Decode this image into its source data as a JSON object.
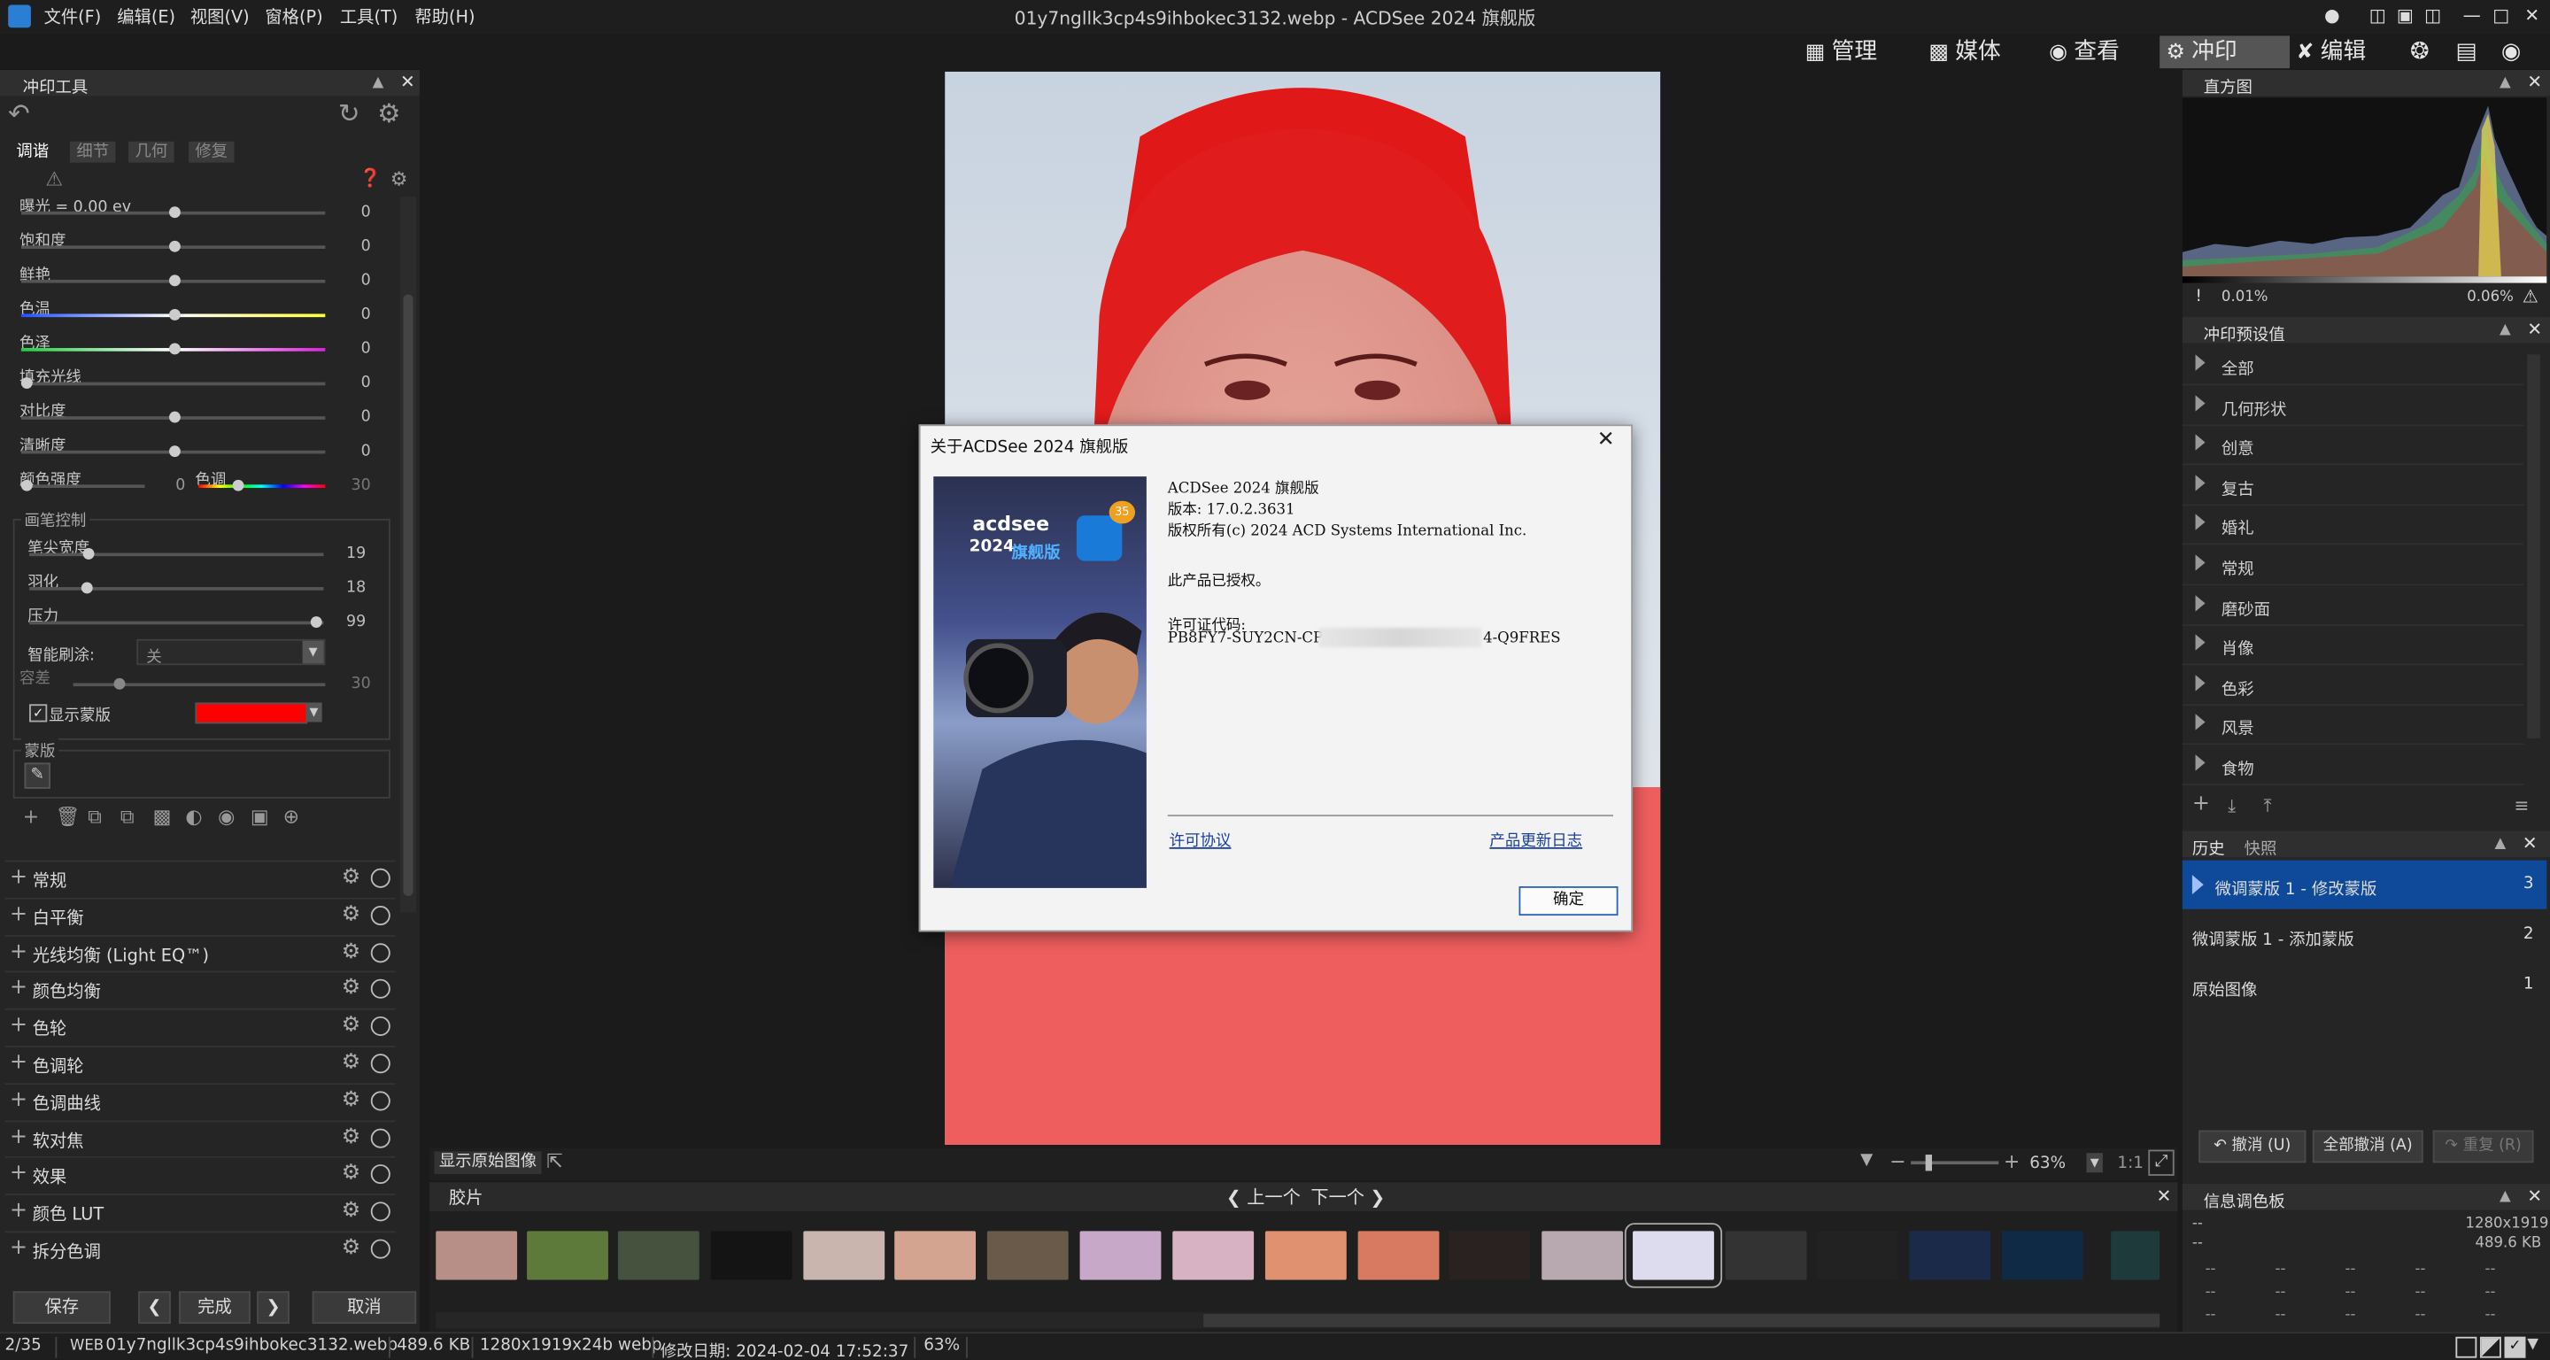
{
  "window": {
    "title": "01y7ngllk3cp4s9ihbokec3132.webp - ACDSee 2024 旗舰版"
  },
  "menu": [
    "文件(F)",
    "编辑(E)",
    "视图(V)",
    "窗格(P)",
    "工具(T)",
    "帮助(H)"
  ],
  "modes": [
    {
      "label": "管理",
      "icon": "grid-icon"
    },
    {
      "label": "媒体",
      "icon": "media-icon"
    },
    {
      "label": "查看",
      "icon": "eye-icon"
    },
    {
      "label": "冲印",
      "icon": "develop-icon",
      "active": true
    },
    {
      "label": "编辑",
      "icon": "edit-icon"
    }
  ],
  "left_panel": {
    "title": "冲印工具",
    "tabs": [
      "调谐",
      "细节",
      "几何",
      "修复"
    ],
    "sliders": [
      {
        "label": "曝光 = 0.00 ev",
        "value": "0",
        "pos": 0.5
      },
      {
        "label": "饱和度",
        "value": "0",
        "pos": 0.5
      },
      {
        "label": "鲜艳",
        "value": "0",
        "pos": 0.5
      },
      {
        "label": "色温",
        "value": "0",
        "pos": 0.5
      },
      {
        "label": "色泽",
        "value": "0",
        "pos": 0.5
      },
      {
        "label": "填充光线",
        "value": "0",
        "pos": 0.0
      },
      {
        "label": "对比度",
        "value": "0",
        "pos": 0.5
      },
      {
        "label": "清晰度",
        "value": "0",
        "pos": 0.5
      }
    ],
    "color_strength": {
      "label": "颜色强度",
      "hue_label": "色调",
      "value1": "0",
      "value2": "30"
    },
    "brush": {
      "title": "画笔控制",
      "sliders": [
        {
          "label": "笔尖宽度",
          "value": "19",
          "pos": 0.19
        },
        {
          "label": "羽化",
          "value": "18",
          "pos": 0.18
        },
        {
          "label": "压力",
          "value": "99",
          "pos": 0.99
        }
      ],
      "smart_brush_label": "智能刷涂:",
      "smart_brush_value": "关",
      "tolerance_label": "容差",
      "tolerance_value": "30",
      "show_mask_label": "显示蒙版",
      "mask_color": "#ff0000"
    },
    "mask_title": "蒙版",
    "sections": [
      "常规",
      "白平衡",
      "光线均衡 (Light EQ™)",
      "颜色均衡",
      "色轮",
      "色调轮",
      "色调曲线",
      "软对焦",
      "效果",
      "颜色 LUT",
      "拆分色调"
    ],
    "buttons": {
      "save": "保存",
      "done": "完成",
      "cancel": "取消"
    }
  },
  "about_dialog": {
    "title": "关于ACDSee 2024 旗舰版",
    "splash_brand": "acdsee",
    "splash_year": "2024",
    "splash_edition": "旗舰版",
    "splash_badge": "35",
    "product": "ACDSee 2024 旗舰版",
    "version": "版本: 17.0.2.3631",
    "copyright": "版权所有(c) 2024 ACD Systems International Inc.",
    "licensed": "此产品已授权。",
    "license_code_label": "许可证代码:",
    "license_code_start": "PB8FY7-SUY2CN-CPQG",
    "license_code_end": "4-Q9FRES",
    "link_license": "许可协议",
    "link_changelog": "产品更新日志",
    "ok": "确定"
  },
  "center_bottom": {
    "show_original": "显示原始图像",
    "zoom": "63%",
    "ratio": "1:1"
  },
  "right_panel": {
    "histogram_title": "直方图",
    "hist_left": "0.01%",
    "hist_right": "0.06%",
    "presets_title": "冲印预设值",
    "presets": [
      "全部",
      "几何形状",
      "创意",
      "复古",
      "婚礼",
      "常规",
      "磨砂面",
      "肖像",
      "色彩",
      "风景",
      "食物"
    ],
    "history_tabs": [
      "历史",
      "快照"
    ],
    "history": [
      {
        "label": "微调蒙版 1 - 修改蒙版",
        "num": "3"
      },
      {
        "label": "微调蒙版 1 - 添加蒙版",
        "num": "2"
      },
      {
        "label": "原始图像",
        "num": "1"
      }
    ],
    "undo": "撤消 (U)",
    "undo_all": "全部撤消 (A)",
    "redo": "重复 (R)",
    "info_title": "信息调色板",
    "info_dims": "1280x1919",
    "info_size": "489.6 KB",
    "info_dash": "--"
  },
  "filmstrip": {
    "title": "胶片",
    "prev": "上一个",
    "next": "下一个"
  },
  "status": {
    "index": "2/35",
    "format": "WEB",
    "filename": "01y7ngllk3cp4s9ihbokec3132.webp",
    "size": "489.6 KB",
    "dims": "1280x1919x24b webp",
    "modified": "修改日期: 2024-02-04 17:52:37",
    "zoom": "63%"
  }
}
